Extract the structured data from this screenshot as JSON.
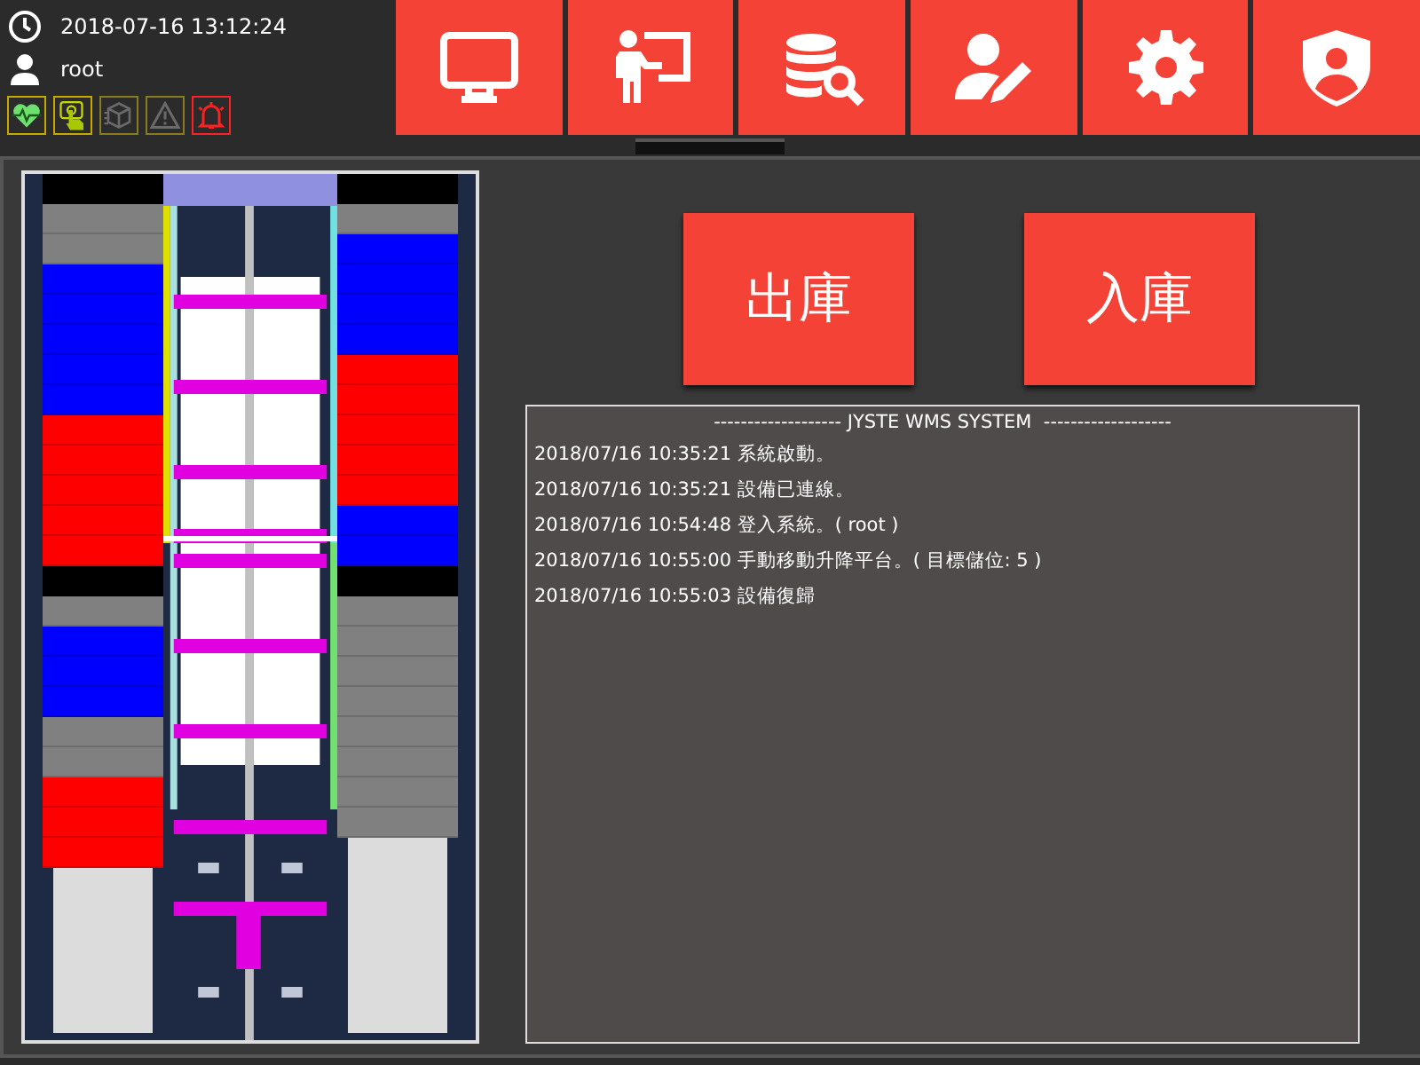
{
  "header": {
    "datetime": "2018-07-16 13:12:24",
    "user": "root",
    "status_icons": [
      {
        "kind": "heartbeat",
        "on": true
      },
      {
        "kind": "touch",
        "on": true
      },
      {
        "kind": "box",
        "on": false
      },
      {
        "kind": "warning",
        "on": false
      },
      {
        "kind": "alarm",
        "on": true
      }
    ],
    "nav_buttons": [
      {
        "kind": "monitor"
      },
      {
        "kind": "presenter"
      },
      {
        "kind": "database-search"
      },
      {
        "kind": "user-edit"
      },
      {
        "kind": "gear"
      },
      {
        "kind": "user-shield"
      }
    ]
  },
  "storage": {
    "left_slots": [
      {
        "color": "#000000"
      },
      {
        "color": "#808080"
      },
      {
        "color": "#808080"
      },
      {
        "color": "#0000ff"
      },
      {
        "color": "#0000ff"
      },
      {
        "color": "#0000ff"
      },
      {
        "color": "#0000ff"
      },
      {
        "color": "#0000ff"
      },
      {
        "color": "#ff0000"
      },
      {
        "color": "#ff0000"
      },
      {
        "color": "#ff0000"
      },
      {
        "color": "#ff0000"
      },
      {
        "color": "#ff0000"
      },
      {
        "color": "#000000"
      },
      {
        "color": "#808080"
      },
      {
        "color": "#0000ff"
      },
      {
        "color": "#0000ff"
      },
      {
        "color": "#0000ff"
      },
      {
        "color": "#808080"
      },
      {
        "color": "#808080"
      },
      {
        "color": "#ff0000"
      },
      {
        "color": "#ff0000"
      },
      {
        "color": "#ff0000"
      }
    ],
    "right_slots": [
      {
        "color": "#000000"
      },
      {
        "color": "#808080"
      },
      {
        "color": "#0000ff"
      },
      {
        "color": "#0000ff"
      },
      {
        "color": "#0000ff"
      },
      {
        "color": "#0000ff"
      },
      {
        "color": "#ff0000"
      },
      {
        "color": "#ff0000"
      },
      {
        "color": "#ff0000"
      },
      {
        "color": "#ff0000"
      },
      {
        "color": "#ff0000"
      },
      {
        "color": "#0000ff"
      },
      {
        "color": "#0000ff"
      },
      {
        "color": "#000000"
      },
      {
        "color": "#808080"
      },
      {
        "color": "#808080"
      },
      {
        "color": "#808080"
      },
      {
        "color": "#808080"
      },
      {
        "color": "#808080"
      },
      {
        "color": "#808080"
      },
      {
        "color": "#808080"
      },
      {
        "color": "#808080"
      }
    ]
  },
  "actions": [
    "出庫",
    "入庫"
  ],
  "log": {
    "title": "------------------- JYSTE WMS SYSTEM  -------------------",
    "entries": [
      "2018/07/16 10:35:21 系統啟動。",
      "2018/07/16 10:35:21 設備已連線。",
      "2018/07/16 10:54:48 登入系統。( root )",
      "2018/07/16 10:55:00 手動移動升降平台。( 目標儲位: 5 )",
      "2018/07/16 10:55:03 設備復歸"
    ]
  }
}
